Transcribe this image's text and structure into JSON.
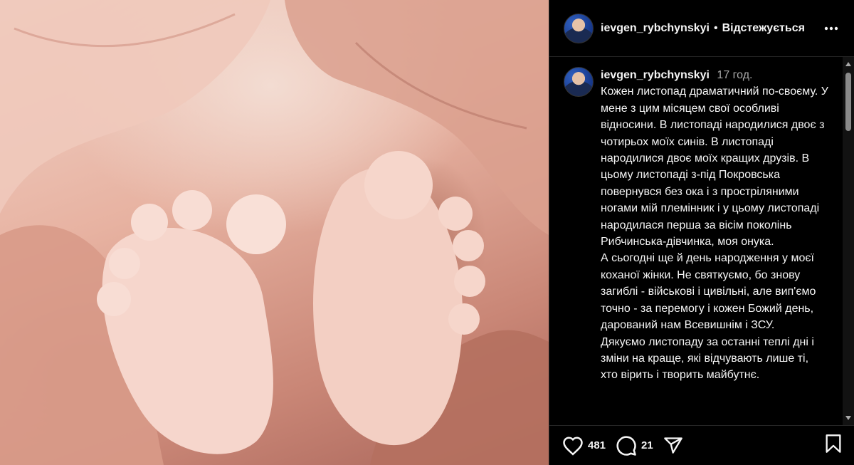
{
  "post": {
    "username": "ievgen_rybchynskyi",
    "follow_label": "Відстежується",
    "time_ago": "17 год.",
    "caption": "Кожен листопад драматичний по-своєму. У мене з цим місяцем свої особливі відносини. В листопаді народилися двоє з чотирьох моїх синів. В листопаді народилися двоє моїх кращих друзів. В цьому листопаді з-під Покровська повернувся без ока і з простріляними ногами мій племінник і у цьому листопаді народилася перша за вісім поколінь Рибчинська-дівчинка, моя онука.\nА сьогодні ще й день народження у моєї коханої жінки. Не святкуємо, бо знову загиблі - військові і цивільні, але вип'ємо точно - за перемогу і кожен Божий день, дарований нам Всевишнім і ЗСУ.\nДякуємо листопаду за останні теплі дні і зміни на краще, які відчувають лише ті, хто вірить і творить майбутнє.",
    "likes": "481",
    "comments": "21"
  },
  "icons": {
    "more": "more-options-icon",
    "like": "heart-icon",
    "comment": "comment-icon",
    "share": "share-icon",
    "save": "bookmark-icon"
  },
  "colors": {
    "background": "#000000",
    "text": "#f5f5f5",
    "muted": "#a8a8a8",
    "divider": "#262626"
  }
}
